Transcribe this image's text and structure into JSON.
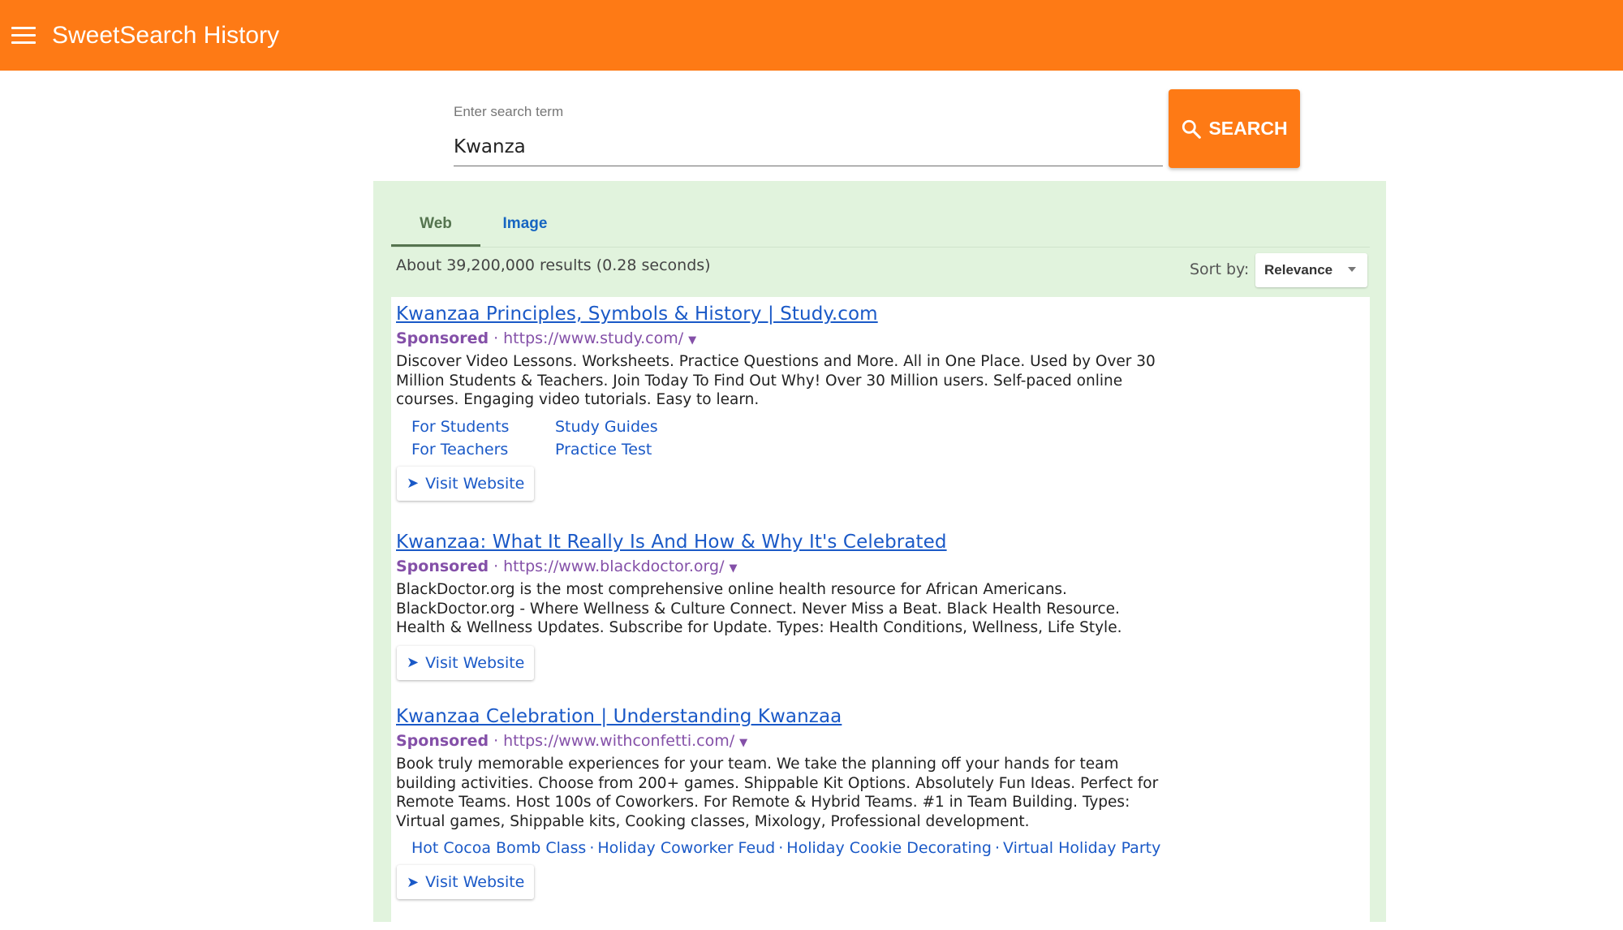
{
  "appbar": {
    "title": "SweetSearch History",
    "menu_icon": "hamburger-menu-icon",
    "color": "#fe7a15"
  },
  "search": {
    "label": "Enter search term",
    "value": "Kwanza",
    "button_label": "SEARCH",
    "button_icon": "search-icon"
  },
  "tabs": [
    {
      "label": "Web",
      "active": true
    },
    {
      "label": "Image",
      "active": false
    }
  ],
  "results_info": {
    "count_text": "About 39,200,000 results (0.28 seconds)",
    "sort_label": "Sort by:",
    "sort_value": "Relevance"
  },
  "results": [
    {
      "title": "Kwanzaa Principles, Symbols & History | Study.com",
      "sponsored": "Sponsored",
      "url": "https://www.study.com/",
      "description": "Discover Video Lessons. Worksheets. Practice Questions and More. All in One Place. Used by Over 30 Million Students & Teachers. Join Today To Find Out Why! Over 30 Million users. Self-paced online courses. Engaging video tutorials. Easy to learn.",
      "sitelinks": [
        "For Students",
        "Study Guides",
        "For Teachers",
        "Practice Test"
      ],
      "visit_label": "Visit Website"
    },
    {
      "title": "Kwanzaa: What It Really Is And How & Why It's Celebrated",
      "sponsored": "Sponsored",
      "url": "https://www.blackdoctor.org/",
      "description": "BlackDoctor.org is the most comprehensive online health resource for African Americans. BlackDoctor.org - Where Wellness & Culture Connect. Never Miss a Beat. Black Health Resource. Health & Wellness Updates. Subscribe for Update. Types: Health Conditions, Wellness, Life Style.",
      "visit_label": "Visit Website"
    },
    {
      "title": "Kwanzaa Celebration | Understanding Kwanzaa",
      "sponsored": "Sponsored",
      "url": "https://www.withconfetti.com/",
      "description": "Book truly memorable experiences for your team. We take the planning off your hands for team building activities. Choose from 200+ games. Shippable Kit Options. Absolutely Fun Ideas. Perfect for Remote Teams. Host 100s of Coworkers. For Remote & Hybrid Teams. #1 in Team Building. Types: Virtual games, Shippable kits, Cooking classes, Mixology, Professional development.",
      "inline_links": [
        "Hot Cocoa Bomb Class",
        "Holiday Coworker Feud",
        "Holiday Cookie Decorating",
        "Virtual Holiday Party"
      ],
      "visit_label": "Visit Website"
    }
  ],
  "colors": {
    "accent": "#fe7a15",
    "panel_bg": "#e1f3dd",
    "link": "#1a59c7",
    "sponsored": "#8450a8"
  }
}
